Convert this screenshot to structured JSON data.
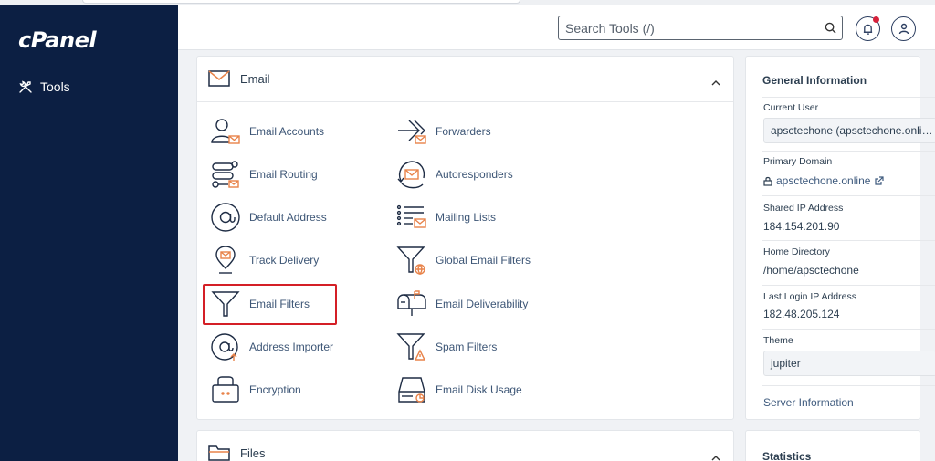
{
  "app": {
    "logo": "cPanel"
  },
  "sidebar": {
    "items": [
      {
        "label": "Tools",
        "icon": "tools-icon"
      }
    ]
  },
  "header": {
    "search_placeholder": "Search Tools (/)"
  },
  "email_section": {
    "title": "Email",
    "tools": [
      {
        "label": "Email Accounts",
        "icon": "email-accounts-icon"
      },
      {
        "label": "Forwarders",
        "icon": "forwarders-icon"
      },
      {
        "label": "Email Routing",
        "icon": "email-routing-icon"
      },
      {
        "label": "Autoresponders",
        "icon": "autoresponders-icon"
      },
      {
        "label": "Default Address",
        "icon": "at-sign-icon"
      },
      {
        "label": "Mailing Lists",
        "icon": "mailing-lists-icon"
      },
      {
        "label": "Track Delivery",
        "icon": "map-pin-mail-icon"
      },
      {
        "label": "Global Email Filters",
        "icon": "funnel-globe-icon"
      },
      {
        "label": "Email Filters",
        "icon": "funnel-icon"
      },
      {
        "label": "Email Deliverability",
        "icon": "mailbox-icon"
      },
      {
        "label": "Address Importer",
        "icon": "at-import-icon"
      },
      {
        "label": "Spam Filters",
        "icon": "funnel-warning-icon"
      },
      {
        "label": "Encryption",
        "icon": "encryption-icon"
      },
      {
        "label": "Email Disk Usage",
        "icon": "disk-usage-icon"
      }
    ]
  },
  "files_section": {
    "title": "Files"
  },
  "general_info": {
    "title": "General Information",
    "current_user_label": "Current User",
    "current_user": "apsctechone (apsctechone.onli…",
    "primary_domain_label": "Primary Domain",
    "primary_domain": "apsctechone.online",
    "shared_ip_label": "Shared IP Address",
    "shared_ip": "184.154.201.90",
    "home_dir_label": "Home Directory",
    "home_dir": "/home/apsctechone",
    "last_login_label": "Last Login IP Address",
    "last_login": "182.48.205.124",
    "theme_label": "Theme",
    "theme": "jupiter",
    "server_info": "Server Information"
  },
  "statistics": {
    "title": "Statistics"
  },
  "colors": {
    "sidebar": "#0c1f43",
    "accent_orange": "#e8834a",
    "highlight": "#d41f26"
  }
}
